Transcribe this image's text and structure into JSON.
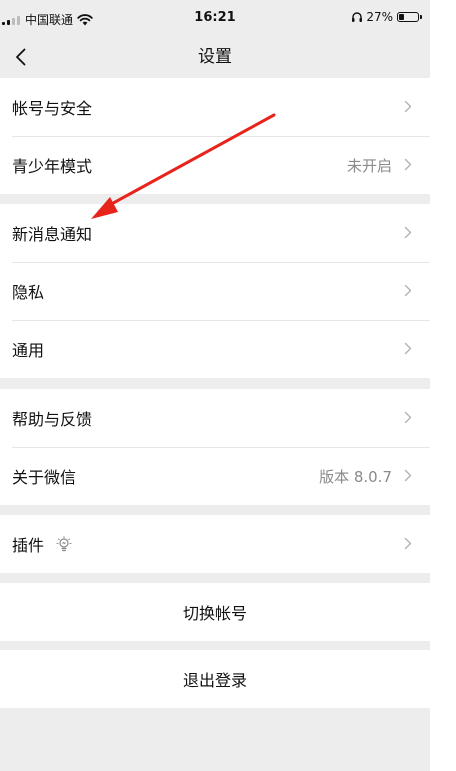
{
  "status_bar": {
    "carrier": "中国联通",
    "time": "16:21",
    "battery": "27%",
    "battery_level": 0.27
  },
  "nav": {
    "title": "设置"
  },
  "groups": [
    {
      "items": [
        {
          "label": "帐号与安全",
          "value": ""
        },
        {
          "label": "青少年模式",
          "value": "未开启"
        }
      ]
    },
    {
      "items": [
        {
          "label": "新消息通知",
          "value": ""
        },
        {
          "label": "隐私",
          "value": ""
        },
        {
          "label": "通用",
          "value": ""
        }
      ]
    },
    {
      "items": [
        {
          "label": "帮助与反馈",
          "value": ""
        },
        {
          "label": "关于微信",
          "value": "版本 8.0.7"
        }
      ]
    },
    {
      "items": [
        {
          "label": "插件",
          "value": ""
        }
      ]
    }
  ],
  "actions": {
    "switch_account": "切换帐号",
    "logout": "退出登录"
  },
  "colors": {
    "background": "#ededed",
    "annotation_arrow": "#e8231c"
  }
}
